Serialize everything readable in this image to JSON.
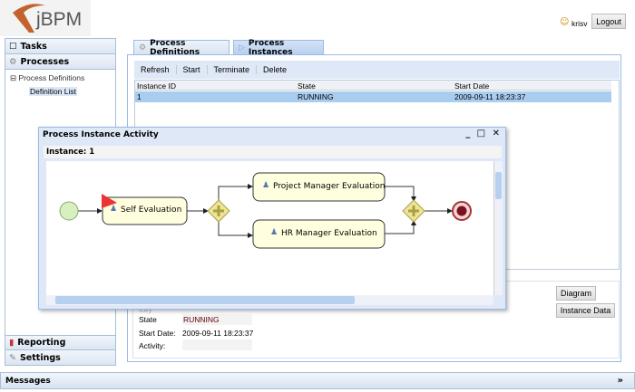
{
  "header": {
    "logo": "jBPM",
    "user": "krisv",
    "logout_label": "Logout"
  },
  "sidebar": {
    "tasks": "Tasks",
    "processes": "Processes",
    "tree_parent": "Process Definitions",
    "tree_child": "Definition List",
    "reporting": "Reporting",
    "settings": "Settings"
  },
  "tabs": [
    "Process Definitions",
    "Process Instances"
  ],
  "toolbar": [
    "Refresh",
    "Start",
    "Terminate",
    "Delete"
  ],
  "grid": {
    "columns": [
      "Instance ID",
      "State",
      "Start Date"
    ],
    "rows": [
      [
        "1",
        "RUNNING",
        "2009-09-11 18:23:37"
      ]
    ]
  },
  "popup": {
    "title": "Process Instance Activity",
    "controls": "_ □ ✕",
    "instance_label": "Instance: 1",
    "nodes": {
      "self": "Self Evaluation",
      "pm": "Project Manager Evaluation",
      "hr": "HR Manager Evaluation"
    }
  },
  "detail": {
    "key_label": "Key",
    "state_label": "State",
    "state_value": "RUNNING",
    "start_label": "Start Date:",
    "start_value": "2009-09-11 18:23:37",
    "activity_label": "Activity:",
    "activity_value": "",
    "diagram_button": "Diagram",
    "instance_data_button": "Instance Data"
  },
  "messages": {
    "title": "Messages",
    "toggle": "»"
  }
}
